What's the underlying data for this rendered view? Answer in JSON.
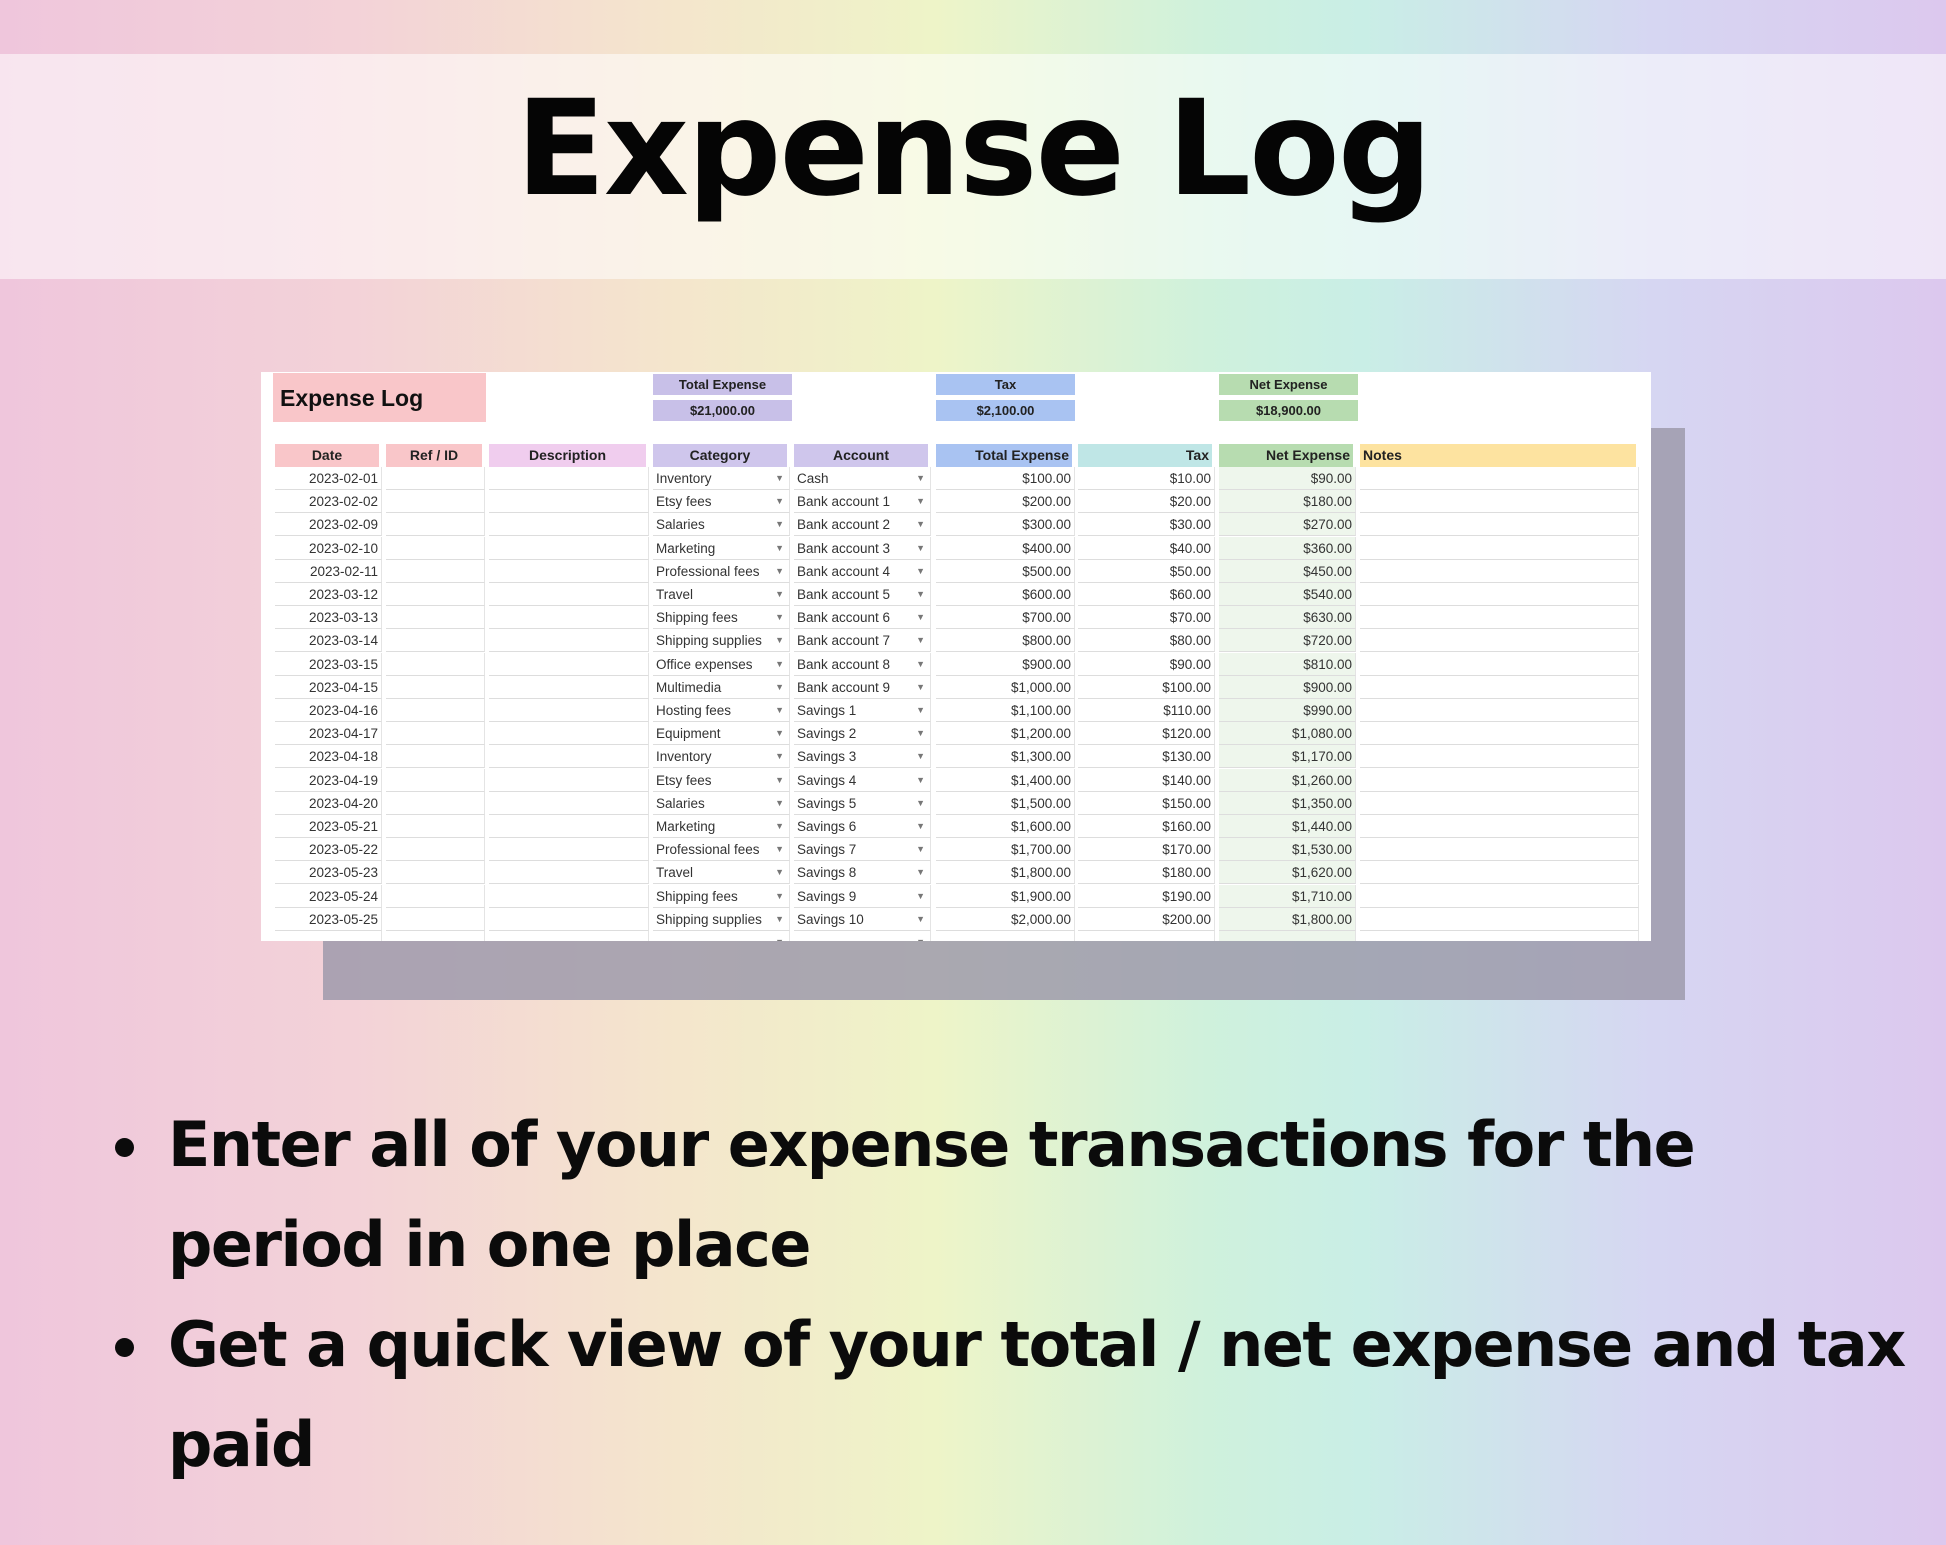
{
  "page_title": "Expense Log",
  "sheet": {
    "title": "Expense Log",
    "summary": [
      {
        "label": "Total Expense",
        "value": "$21,000.00",
        "color": "#c8c0e8"
      },
      {
        "label": "Tax",
        "value": "$2,100.00",
        "color": "#a9c3f2"
      },
      {
        "label": "Net Expense",
        "value": "$18,900.00",
        "color": "#b7dcb0"
      }
    ],
    "columns": [
      {
        "label": "Date",
        "color": "#f9c6c9"
      },
      {
        "label": "Ref / ID",
        "color": "#f9c6c9"
      },
      {
        "label": "Description",
        "color": "#f0cdee"
      },
      {
        "label": "Category",
        "color": "#cfc6ec"
      },
      {
        "label": "Account",
        "color": "#cfc6ec"
      },
      {
        "label": "Total Expense",
        "color": "#a9c3f2"
      },
      {
        "label": "Tax",
        "color": "#bfe6e6"
      },
      {
        "label": "Net Expense",
        "color": "#b7dcb0"
      },
      {
        "label": "Notes",
        "color": "#fde3a0"
      }
    ],
    "rows": [
      [
        "2023-02-01",
        "",
        "",
        "Inventory",
        "Cash",
        "$100.00",
        "$10.00",
        "$90.00",
        ""
      ],
      [
        "2023-02-02",
        "",
        "",
        "Etsy fees",
        "Bank account 1",
        "$200.00",
        "$20.00",
        "$180.00",
        ""
      ],
      [
        "2023-02-09",
        "",
        "",
        "Salaries",
        "Bank account 2",
        "$300.00",
        "$30.00",
        "$270.00",
        ""
      ],
      [
        "2023-02-10",
        "",
        "",
        "Marketing",
        "Bank account 3",
        "$400.00",
        "$40.00",
        "$360.00",
        ""
      ],
      [
        "2023-02-11",
        "",
        "",
        "Professional fees",
        "Bank account 4",
        "$500.00",
        "$50.00",
        "$450.00",
        ""
      ],
      [
        "2023-03-12",
        "",
        "",
        "Travel",
        "Bank account 5",
        "$600.00",
        "$60.00",
        "$540.00",
        ""
      ],
      [
        "2023-03-13",
        "",
        "",
        "Shipping fees",
        "Bank account 6",
        "$700.00",
        "$70.00",
        "$630.00",
        ""
      ],
      [
        "2023-03-14",
        "",
        "",
        "Shipping supplies",
        "Bank account 7",
        "$800.00",
        "$80.00",
        "$720.00",
        ""
      ],
      [
        "2023-03-15",
        "",
        "",
        "Office expenses",
        "Bank account 8",
        "$900.00",
        "$90.00",
        "$810.00",
        ""
      ],
      [
        "2023-04-15",
        "",
        "",
        "Multimedia",
        "Bank account 9",
        "$1,000.00",
        "$100.00",
        "$900.00",
        ""
      ],
      [
        "2023-04-16",
        "",
        "",
        "Hosting fees",
        "Savings 1",
        "$1,100.00",
        "$110.00",
        "$990.00",
        ""
      ],
      [
        "2023-04-17",
        "",
        "",
        "Equipment",
        "Savings 2",
        "$1,200.00",
        "$120.00",
        "$1,080.00",
        ""
      ],
      [
        "2023-04-18",
        "",
        "",
        "Inventory",
        "Savings 3",
        "$1,300.00",
        "$130.00",
        "$1,170.00",
        ""
      ],
      [
        "2023-04-19",
        "",
        "",
        "Etsy fees",
        "Savings 4",
        "$1,400.00",
        "$140.00",
        "$1,260.00",
        ""
      ],
      [
        "2023-04-20",
        "",
        "",
        "Salaries",
        "Savings 5",
        "$1,500.00",
        "$150.00",
        "$1,350.00",
        ""
      ],
      [
        "2023-05-21",
        "",
        "",
        "Marketing",
        "Savings 6",
        "$1,600.00",
        "$160.00",
        "$1,440.00",
        ""
      ],
      [
        "2023-05-22",
        "",
        "",
        "Professional fees",
        "Savings 7",
        "$1,700.00",
        "$170.00",
        "$1,530.00",
        ""
      ],
      [
        "2023-05-23",
        "",
        "",
        "Travel",
        "Savings 8",
        "$1,800.00",
        "$180.00",
        "$1,620.00",
        ""
      ],
      [
        "2023-05-24",
        "",
        "",
        "Shipping fees",
        "Savings 9",
        "$1,900.00",
        "$190.00",
        "$1,710.00",
        ""
      ],
      [
        "2023-05-25",
        "",
        "",
        "Shipping supplies",
        "Savings 10",
        "$2,000.00",
        "$200.00",
        "$1,800.00",
        ""
      ],
      [
        "",
        "",
        "",
        "",
        "",
        "",
        "",
        "",
        ""
      ]
    ]
  },
  "bullets": [
    "Enter all of your expense transactions for the period in one place",
    "Get a quick view of your total / net expense and tax paid"
  ]
}
